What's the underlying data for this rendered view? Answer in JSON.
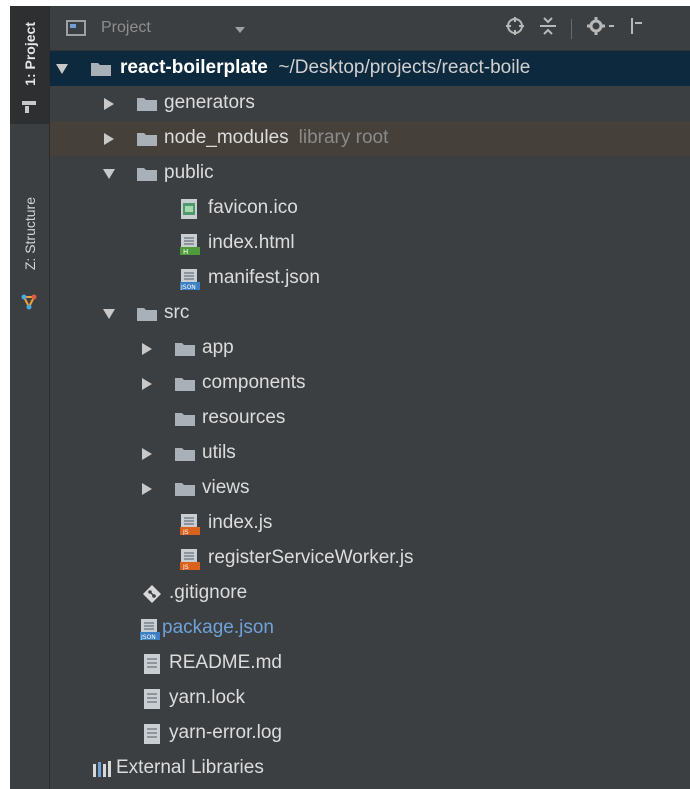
{
  "sidebar": {
    "project_tab": "1: Project",
    "structure_tab": "Z: Structure"
  },
  "header": {
    "title": "Project",
    "icons": [
      "locate-icon",
      "collapse-all-icon",
      "settings-gear-icon",
      "hide-icon"
    ]
  },
  "tree": {
    "root": {
      "name": "react-boilerplate",
      "path": "~/Desktop/projects/react-boile"
    },
    "generators": "generators",
    "node_modules": {
      "name": "node_modules",
      "hint": "library root"
    },
    "public": "public",
    "favicon": "favicon.ico",
    "index_html": "index.html",
    "manifest": "manifest.json",
    "src": "src",
    "app": "app",
    "components": "components",
    "resources": "resources",
    "utils": "utils",
    "views": "views",
    "index_js": "index.js",
    "register_sw": "registerServiceWorker.js",
    "gitignore": ".gitignore",
    "package_json": "package.json",
    "readme": "README.md",
    "yarn_lock": "yarn.lock",
    "yarn_error": "yarn-error.log",
    "external_libraries": "External Libraries"
  },
  "colors": {
    "panel_bg": "#3c3f41",
    "selection": "#0d293e",
    "library_row": "#45403a",
    "folder": "#a9b0b7",
    "modified_blue": "#6fa1d8"
  }
}
